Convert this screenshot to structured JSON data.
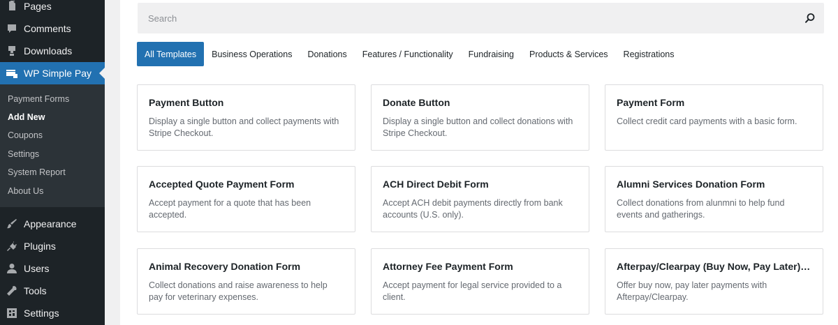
{
  "sidebar": {
    "menu_top": [
      {
        "label": "Pages",
        "icon": "pages-icon"
      },
      {
        "label": "Comments",
        "icon": "comments-icon"
      },
      {
        "label": "Downloads",
        "icon": "downloads-icon"
      },
      {
        "label": "WP Simple Pay",
        "icon": "simple-pay-icon"
      }
    ],
    "submenu": [
      {
        "label": "Payment Forms"
      },
      {
        "label": "Add New"
      },
      {
        "label": "Coupons"
      },
      {
        "label": "Settings"
      },
      {
        "label": "System Report"
      },
      {
        "label": "About Us"
      }
    ],
    "menu_bottom": [
      {
        "label": "Appearance",
        "icon": "appearance-icon"
      },
      {
        "label": "Plugins",
        "icon": "plugins-icon"
      },
      {
        "label": "Users",
        "icon": "users-icon"
      },
      {
        "label": "Tools",
        "icon": "tools-icon"
      },
      {
        "label": "Settings",
        "icon": "settings-icon"
      }
    ],
    "colors": {
      "background": "#1d2327",
      "active": "#2271b1",
      "submenu": "#2c3338"
    }
  },
  "search": {
    "placeholder": "Search",
    "value": ""
  },
  "tabs": [
    {
      "label": "All Templates",
      "active": true
    },
    {
      "label": "Business Operations"
    },
    {
      "label": "Donations"
    },
    {
      "label": "Features / Functionality"
    },
    {
      "label": "Fundraising"
    },
    {
      "label": "Products & Services"
    },
    {
      "label": "Registrations"
    }
  ],
  "templates": [
    {
      "title": "Payment Button",
      "description": "Display a single button and collect payments with Stripe Checkout."
    },
    {
      "title": "Donate Button",
      "description": "Display a single button and collect donations with Stripe Checkout."
    },
    {
      "title": "Payment Form",
      "description": "Collect credit card payments with a basic form."
    },
    {
      "title": "Accepted Quote Payment Form",
      "description": "Accept payment for a quote that has been accepted."
    },
    {
      "title": "ACH Direct Debit Form",
      "description": "Accept ACH debit payments directly from bank accounts (U.S. only)."
    },
    {
      "title": "Alumni Services Donation Form",
      "description": "Collect donations from alunmni to help fund events and gatherings."
    },
    {
      "title": "Animal Recovery Donation Form",
      "description": "Collect donations and raise awareness to help pay for veterinary expenses."
    },
    {
      "title": "Attorney Fee Payment Form",
      "description": "Accept payment for legal service provided to a client."
    },
    {
      "title": "Afterpay/Clearpay (Buy Now, Pay Later) Form",
      "description": "Offer buy now, pay later payments with Afterpay/Clearpay."
    }
  ]
}
